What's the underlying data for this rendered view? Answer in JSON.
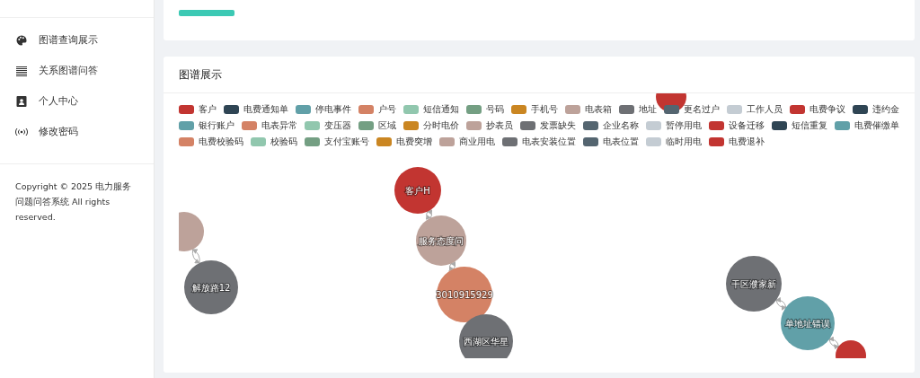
{
  "sidebar": {
    "items": [
      {
        "label": "图谱查询展示"
      },
      {
        "label": "关系图谱问答"
      },
      {
        "label": "个人中心"
      },
      {
        "label": "修改密码"
      }
    ],
    "copyright": "Copyright © 2025 电力服务问题问答系统 All rights reserved."
  },
  "graph_card": {
    "title": "图谱展示",
    "legend": [
      {
        "label": "客户",
        "color": "#c23531"
      },
      {
        "label": "电费通知单",
        "color": "#2f4554"
      },
      {
        "label": "停电事件",
        "color": "#61a0a8"
      },
      {
        "label": "户号",
        "color": "#d48265"
      },
      {
        "label": "短信通知",
        "color": "#91c7ae"
      },
      {
        "label": "号码",
        "color": "#749f83"
      },
      {
        "label": "手机号",
        "color": "#ca8622"
      },
      {
        "label": "电表箱",
        "color": "#bda29a"
      },
      {
        "label": "地址",
        "color": "#6e7074"
      },
      {
        "label": "更名过户",
        "color": "#546570"
      },
      {
        "label": "工作人员",
        "color": "#c4ccd3"
      },
      {
        "label": "电费争议",
        "color": "#c23531"
      },
      {
        "label": "违约金",
        "color": "#2f4554"
      },
      {
        "label": "银行账户",
        "color": "#61a0a8"
      },
      {
        "label": "电表异常",
        "color": "#d48265"
      },
      {
        "label": "变压器",
        "color": "#91c7ae"
      },
      {
        "label": "区域",
        "color": "#749f83"
      },
      {
        "label": "分时电价",
        "color": "#ca8622"
      },
      {
        "label": "抄表员",
        "color": "#bda29a"
      },
      {
        "label": "发票缺失",
        "color": "#6e7074"
      },
      {
        "label": "企业名称",
        "color": "#546570"
      },
      {
        "label": "暂停用电",
        "color": "#c4ccd3"
      },
      {
        "label": "设备迁移",
        "color": "#c23531"
      },
      {
        "label": "短信重复",
        "color": "#2f4554"
      },
      {
        "label": "电费催缴单",
        "color": "#61a0a8"
      },
      {
        "label": "电费校验码",
        "color": "#d48265"
      },
      {
        "label": "校验码",
        "color": "#91c7ae"
      },
      {
        "label": "支付宝账号",
        "color": "#749f83"
      },
      {
        "label": "电费突增",
        "color": "#ca8622"
      },
      {
        "label": "商业用电",
        "color": "#bda29a"
      },
      {
        "label": "电表安装位置",
        "color": "#6e7074"
      },
      {
        "label": "电表位置",
        "color": "#546570"
      },
      {
        "label": "临时用电",
        "color": "#c4ccd3"
      },
      {
        "label": "电费退补",
        "color": "#c23531"
      }
    ],
    "nodes": [
      {
        "color": "#c23531"
      },
      {
        "label": "客户H",
        "color": "#c23531"
      },
      {
        "label": "服务态度问",
        "color": "#bda29a"
      },
      {
        "label": "3010915929",
        "color": "#d48265"
      },
      {
        "label": "西湖区华星",
        "color": "#6e7074"
      },
      {
        "color": "#bda29a"
      },
      {
        "label": "解放路12",
        "color": "#6e7074"
      },
      {
        "label": "干区濮家新",
        "color": "#6e7074"
      },
      {
        "label": "单地址错误",
        "color": "#61a0a8"
      },
      {
        "color": "#c23531"
      }
    ]
  }
}
